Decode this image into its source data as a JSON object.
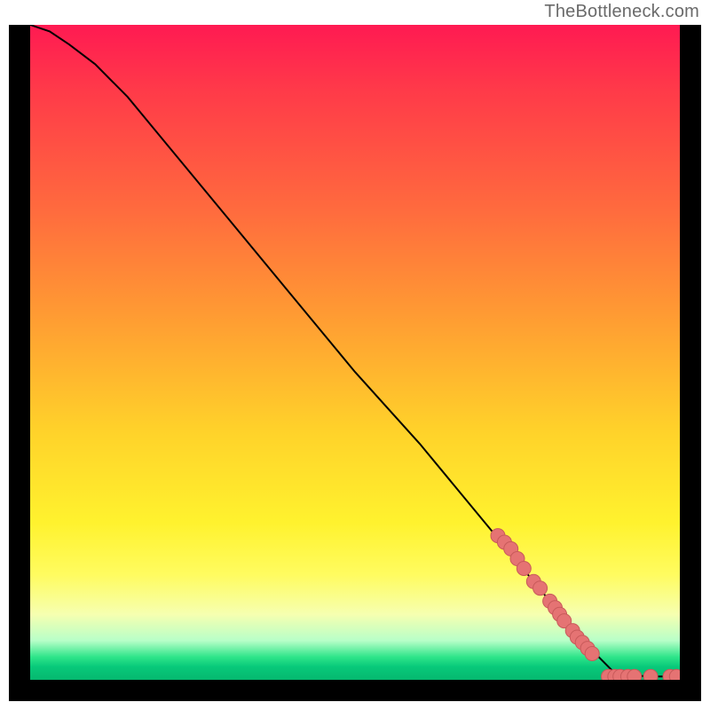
{
  "attribution": "TheBottleneck.com",
  "colors": {
    "frame": "#000000",
    "curve": "#000000",
    "marker_fill": "#e57373",
    "marker_stroke": "#c85a5a",
    "gradient_top": "#ff1a52",
    "gradient_mid": "#ffe030",
    "gradient_bottom": "#06b86f"
  },
  "chart_data": {
    "type": "line",
    "title": "",
    "xlabel": "",
    "ylabel": "",
    "xlim": [
      0,
      100
    ],
    "ylim": [
      0,
      100
    ],
    "curve": {
      "x": [
        0,
        3,
        6,
        10,
        15,
        20,
        30,
        40,
        50,
        60,
        70,
        80,
        85,
        90,
        95,
        100
      ],
      "y": [
        100,
        99,
        97,
        94,
        89,
        83,
        71,
        59,
        47,
        36,
        24,
        12,
        6,
        1,
        0.5,
        0.5
      ]
    },
    "series": [
      {
        "name": "markers-on-curve",
        "type": "scatter",
        "points": [
          {
            "x": 72,
            "y": 22
          },
          {
            "x": 73,
            "y": 21
          },
          {
            "x": 74,
            "y": 20
          },
          {
            "x": 75,
            "y": 18.5
          },
          {
            "x": 76,
            "y": 17
          },
          {
            "x": 77.5,
            "y": 15
          },
          {
            "x": 78.5,
            "y": 14
          },
          {
            "x": 80,
            "y": 12
          },
          {
            "x": 80.8,
            "y": 11
          },
          {
            "x": 81.5,
            "y": 10
          },
          {
            "x": 82.2,
            "y": 9
          },
          {
            "x": 83.5,
            "y": 7.5
          },
          {
            "x": 84.2,
            "y": 6.5
          },
          {
            "x": 85,
            "y": 5.7
          },
          {
            "x": 85.8,
            "y": 4.8
          },
          {
            "x": 86.5,
            "y": 4
          }
        ]
      },
      {
        "name": "markers-baseline",
        "type": "scatter",
        "points": [
          {
            "x": 89,
            "y": 0.5
          },
          {
            "x": 90,
            "y": 0.5
          },
          {
            "x": 90.8,
            "y": 0.5
          },
          {
            "x": 92,
            "y": 0.5
          },
          {
            "x": 93,
            "y": 0.5
          },
          {
            "x": 95.5,
            "y": 0.5
          },
          {
            "x": 98.5,
            "y": 0.5
          },
          {
            "x": 99.5,
            "y": 0.5
          }
        ]
      }
    ]
  }
}
